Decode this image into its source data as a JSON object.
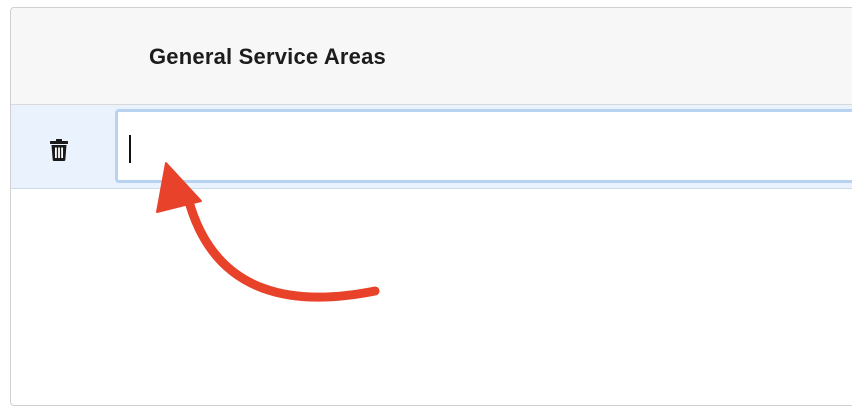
{
  "table": {
    "column_header": "General Service Areas",
    "rows": [
      {
        "value": "",
        "placeholder": ""
      }
    ]
  },
  "icons": {
    "delete": "trash-icon",
    "annotation": "curved-arrow-icon"
  },
  "colors": {
    "header_bg": "#f7f7f7",
    "row_bg": "#eaf3fd",
    "input_focus_border": "#b8d3f0",
    "annotation_arrow": "#e8432a"
  }
}
